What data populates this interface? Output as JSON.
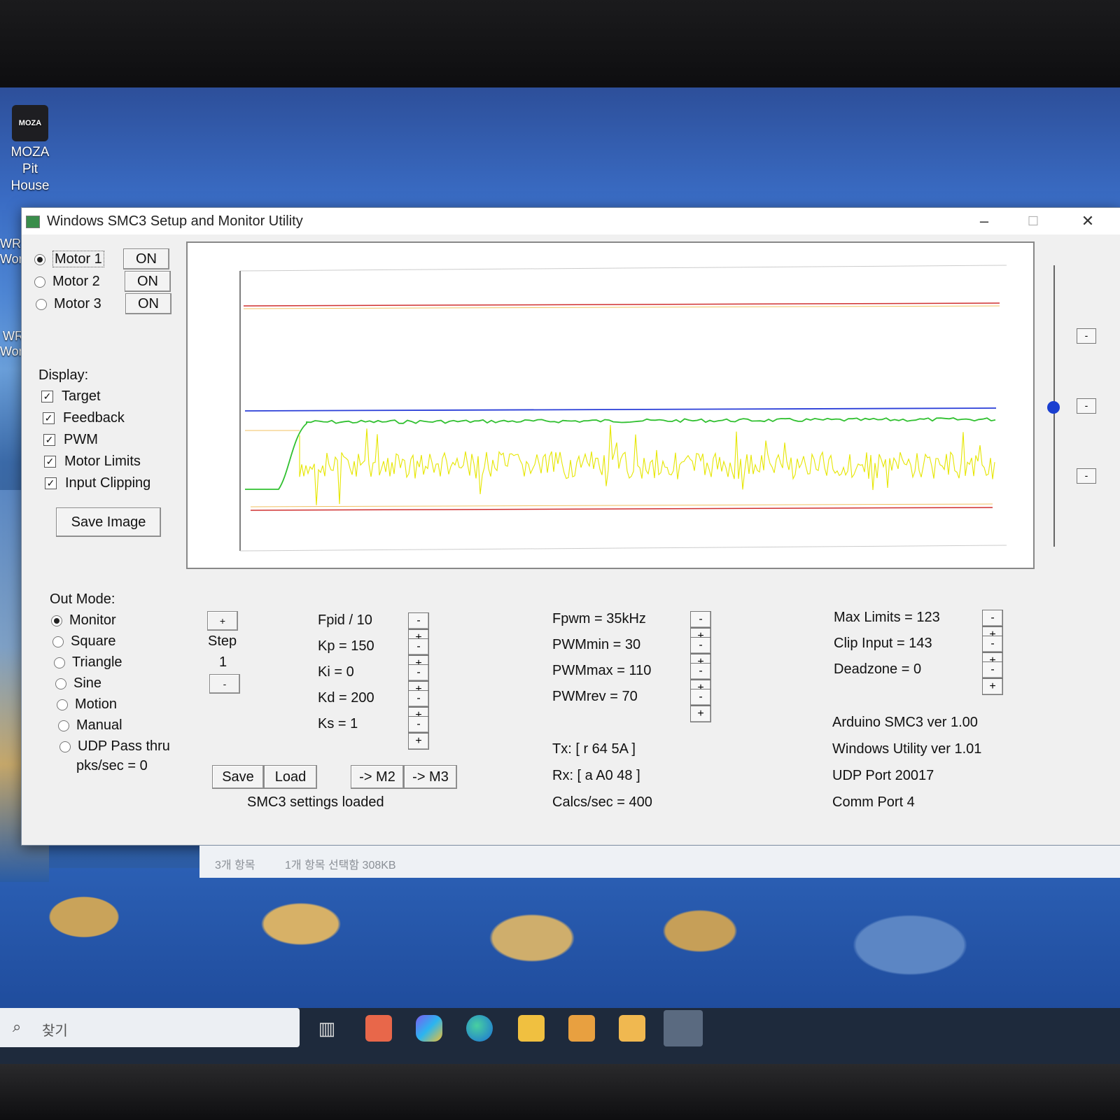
{
  "desktop": {
    "icon_label_1": "MOZA Pit",
    "icon_label_2": "House",
    "icon_badge": "MOZA",
    "edge_1a": "WR",
    "edge_1b": "Wor",
    "edge_2a": "WR",
    "edge_2b": "Wor"
  },
  "window": {
    "title": "Windows SMC3 Setup and Monitor Utility",
    "minimize": "–",
    "maximize": "☐",
    "close": "✕"
  },
  "motors": [
    {
      "label": "Motor 1",
      "button": "ON",
      "selected": true
    },
    {
      "label": "Motor 2",
      "button": "ON",
      "selected": false
    },
    {
      "label": "Motor 3",
      "button": "ON",
      "selected": false
    }
  ],
  "display": {
    "heading": "Display:",
    "items": [
      "Target",
      "Feedback",
      "PWM",
      "Motor Limits",
      "Input Clipping"
    ],
    "save_image": "Save Image"
  },
  "out_mode": {
    "heading": "Out Mode:",
    "items": [
      "Monitor",
      "Square",
      "Triangle",
      "Sine",
      "Motion",
      "Manual",
      "UDP Pass thru"
    ],
    "pks": "pks/sec = 0"
  },
  "step": {
    "plus": "+",
    "label": "Step",
    "value": "1",
    "minus": "-"
  },
  "pid": [
    "Fpid / 10",
    "Kp = 150",
    "Ki = 0",
    "Kd = 200",
    "Ks = 1"
  ],
  "pwm": [
    "Fpwm = 35kHz",
    "PWMmin = 30",
    "PWMmax = 110",
    "PWMrev = 70"
  ],
  "limits": [
    "Max Limits = 123",
    "Clip Input = 143",
    "Deadzone = 0"
  ],
  "pm_labels": {
    "minus": "-",
    "plus": "+"
  },
  "buttons": {
    "save": "Save",
    "load": "Load",
    "m2": "-> M2",
    "m3": "-> M3"
  },
  "status": "SMC3 settings loaded",
  "comm": {
    "tx": "Tx: [ r 64 5A ]",
    "rx": "Rx: [ a A0 48 ]",
    "calcs": "Calcs/sec = 400"
  },
  "info": [
    "Arduino SMC3 ver 1.00",
    "Windows Utility ver 1.01",
    "UDP Port 20017",
    "Comm Port 4"
  ],
  "explorer_strip": {
    "items": "3개 항목",
    "selected": "1개 항목 선택함 308KB"
  },
  "taskbar": {
    "search_placeholder": "찾기"
  },
  "colors": {
    "limit": "#d03030",
    "target": "#2a3ed8",
    "feedback": "#30c030",
    "pwm": "#e6e600",
    "clip": "#f0c060"
  }
}
